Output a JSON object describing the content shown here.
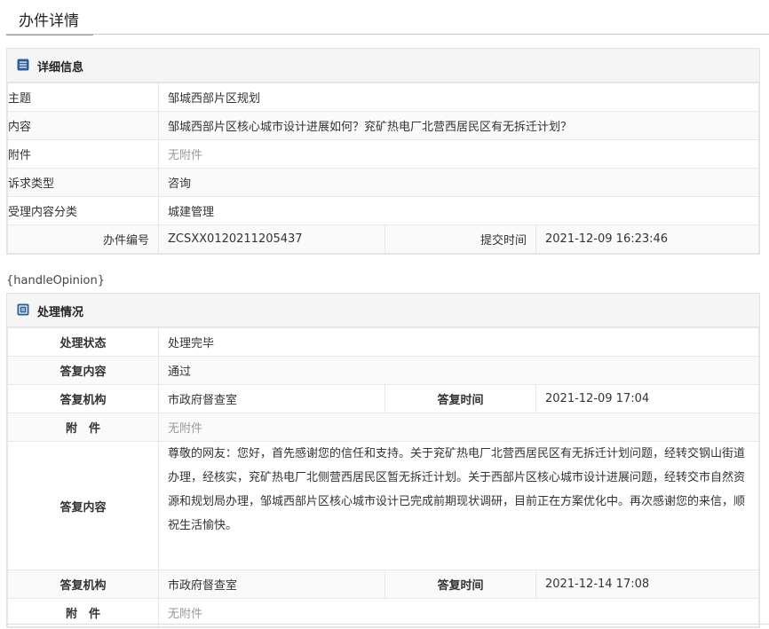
{
  "page": {
    "tab_title": "办件详情",
    "handle_opinion_text": "{handleOpinion}"
  },
  "detail": {
    "title": "详细信息",
    "rows": [
      {
        "label": "主题",
        "value": "邹城西部片区规划"
      },
      {
        "label": "内容",
        "value": "邹城西部片区核心城市设计进展如何？兖矿热电厂北营西居民区有无拆迁计划？"
      },
      {
        "label": "附件",
        "value": "无附件"
      },
      {
        "label": "诉求类型",
        "value": "咨询"
      },
      {
        "label": "受理内容分类",
        "value": "城建管理"
      }
    ],
    "number_label": "办件编号",
    "number_value": "ZCSXX0120211205437",
    "submit_label": "提交时间",
    "submit_value": "2021-12-09 16:23:46"
  },
  "handling": {
    "title": "处理情况",
    "status_label": "处理状态",
    "status_value": "处理完毕",
    "reply1_label": "答复内容",
    "reply1_value": "通过",
    "org1_label": "答复机构",
    "org1_value": "市政府督查室",
    "time1_label": "答复时间",
    "time1_value": "2021-12-09 17:04",
    "att1_label": "附　件",
    "att1_value": "无附件",
    "reply2_label": "答复内容",
    "reply2_value": "尊敬的网友：您好，首先感谢您的信任和支持。关于兖矿热电厂北营西居民区有无拆迁计划问题，经转交钢山街道办理，经核实，兖矿热电厂北侧营西居民区暂无拆迁计划。关于西部片区核心城市设计进展问题，经转交市自然资源和规划局办理，邹城西部片区核心城市设计已完成前期现状调研，目前正在方案优化中。再次感谢您的来信，顺祝生活愉快。",
    "org2_label": "答复机构",
    "org2_value": "市政府督查室",
    "time2_label": "答复时间",
    "time2_value": "2021-12-14 17:08",
    "att2_label": "附　件",
    "att2_value": "无附件"
  }
}
